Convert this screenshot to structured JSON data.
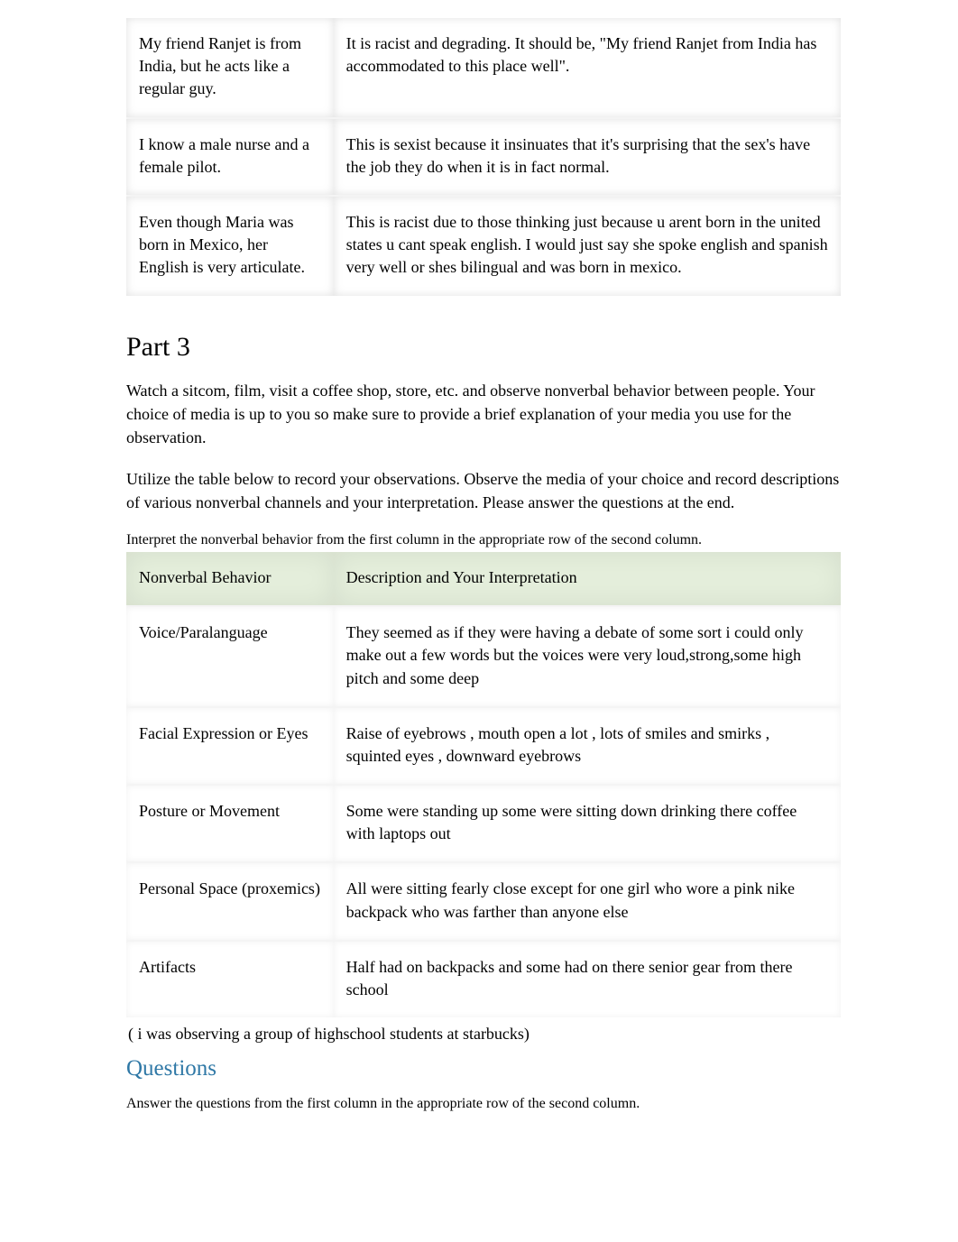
{
  "table1": {
    "rows": [
      {
        "statement": "My friend Ranjet is from India, but he acts like a regular guy.",
        "response": "It is racist and degrading. It should be, \"My friend Ranjet from India has accommodated to this place well\"."
      },
      {
        "statement": "I know a male nurse and a female pilot.",
        "response": "This is sexist because it insinuates that it's surprising that the sex's have the job they do when it is in fact normal."
      },
      {
        "statement": "Even though Maria was born in Mexico, her English is very articulate.",
        "response": "This is racist due to those thinking just because u arent born in the united states u cant speak english. I would just say she spoke english and spanish very well or shes bilingual and was born in mexico."
      }
    ]
  },
  "part3": {
    "title": "Part 3",
    "para1": "Watch a sitcom, film, visit a coffee shop, store, etc. and observe nonverbal behavior between people. Your choice of media is up to you so make sure to provide a brief explanation of your media you use for the observation.",
    "para2": "Utilize the table below to record your observations. Observe the media of your choice and record descriptions of various nonverbal channels and your interpretation. Please answer the questions at the end.",
    "caption": "Interpret the nonverbal behavior from the first column in the appropriate row of the second column.",
    "headers": {
      "c1": "Nonverbal Behavior",
      "c2": "Description and Your Interpretation"
    },
    "rows": [
      {
        "c1": "Voice/Paralanguage",
        "c2": "They seemed as if they were having a debate of some sort i could only make out a few words but the voices were very loud,strong,some high pitch and some deep"
      },
      {
        "c1": "Facial Expression or Eyes",
        "c2": "Raise of eyebrows , mouth open a lot , lots of smiles and smirks , squinted eyes , downward eyebrows"
      },
      {
        "c1": "Posture or Movement",
        "c2": "Some were standing up some were sitting down drinking there coffee with laptops out"
      },
      {
        "c1": "Personal Space (proxemics)",
        "c2": "All were sitting fearly close except for one girl who wore a pink nike backpack who was farther than anyone else"
      },
      {
        "c1": "Artifacts",
        "c2": "Half had on backpacks and some had on there senior gear from there school"
      }
    ],
    "note": " ( i was observing a group of highschool students at starbucks)",
    "questions_title": "Questions",
    "questions_caption": "Answer the questions from the first column in the appropriate row of the second column."
  }
}
